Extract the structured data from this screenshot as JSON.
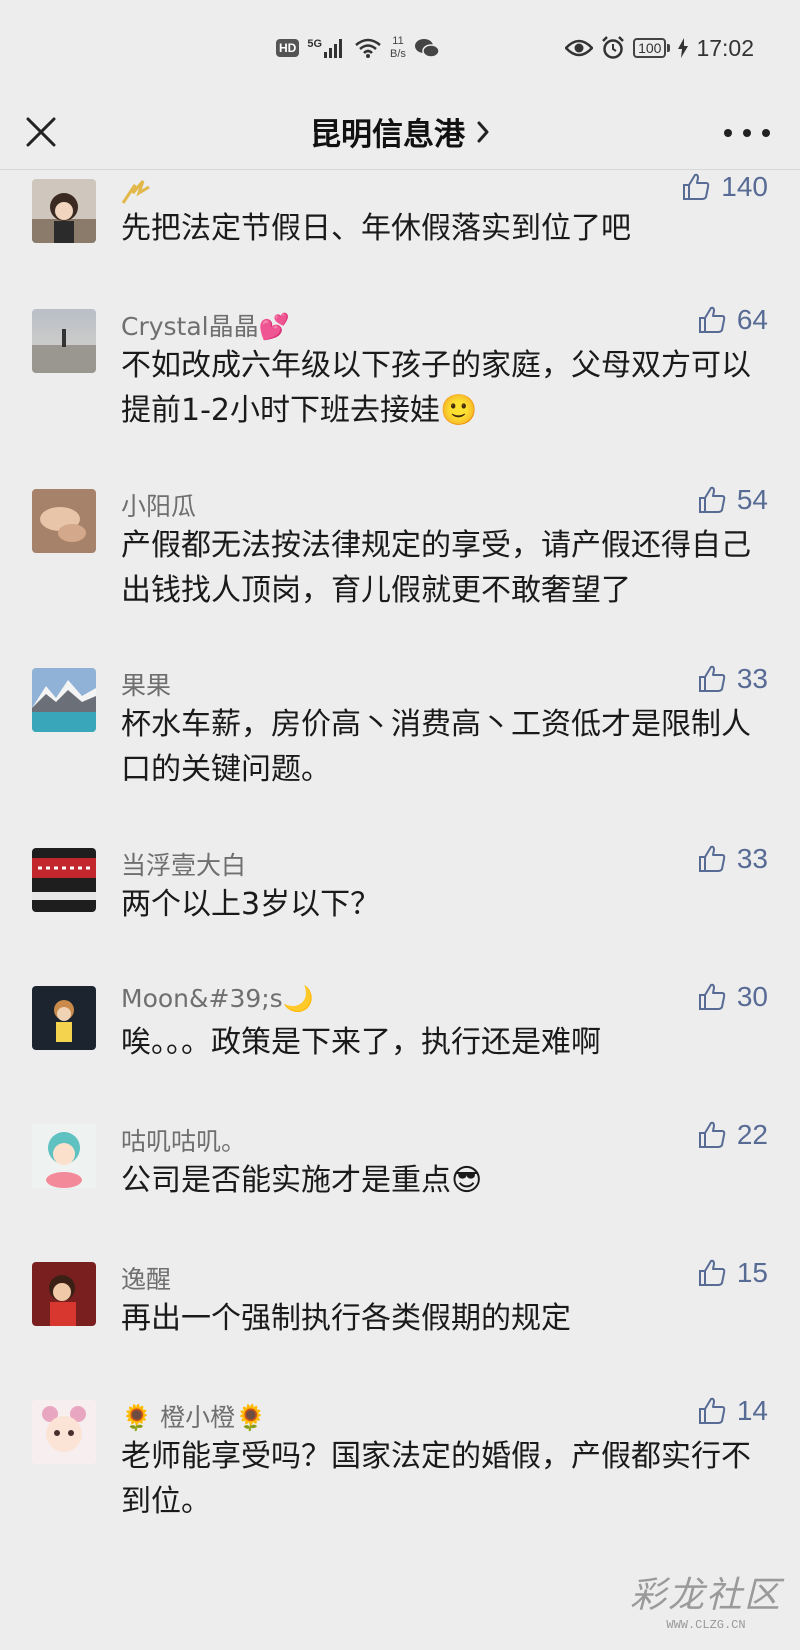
{
  "status_bar": {
    "hd": "HD",
    "signal": "5G",
    "net_speed_value": "11",
    "net_speed_unit": "B/s",
    "battery": "100",
    "time": "17:02"
  },
  "header": {
    "title": "昆明信息港"
  },
  "comments": [
    {
      "name": "",
      "text": "先把法定节假日、年休假落实到位了吧",
      "likes": "140"
    },
    {
      "name": "Crystal晶晶💕",
      "text": "不如改成六年级以下孩子的家庭，父母双方可以提前1-2小时下班去接娃🙂",
      "likes": "64"
    },
    {
      "name": "小阳瓜",
      "text": "产假都无法按法律规定的享受，请产假还得自己出钱找人顶岗，育儿假就更不敢奢望了",
      "likes": "54"
    },
    {
      "name": "果果",
      "text": "杯水车薪，房价高丶消费高丶工资低才是限制人口的关键问题。",
      "likes": "33"
    },
    {
      "name": "当浮壹大白",
      "text": "两个以上3岁以下？",
      "likes": "33"
    },
    {
      "name": "Moon&#39;s🌙",
      "text": "唉。。。政策是下来了，执行还是难啊",
      "likes": "30"
    },
    {
      "name": "咕叽咕叽。",
      "text": "公司是否能实施才是重点😎",
      "likes": "22"
    },
    {
      "name": "逸醒",
      "text": "再出一个强制执行各类假期的规定",
      "likes": "15"
    },
    {
      "name": "🌻 橙小橙🌻",
      "text": "老师能享受吗？国家法定的婚假，产假都实行不到位。",
      "likes": "14"
    }
  ],
  "watermark": {
    "main": "彩龙社区",
    "sub": "WWW.CLZG.CN"
  },
  "colors": {
    "background": "#ededed",
    "like_blue": "#576b95",
    "name_gray": "#6f6f6f"
  },
  "icons": {
    "close": "close-icon",
    "more": "more-icon",
    "like": "thumbs-up-icon",
    "chevron": "chevron-right-icon"
  }
}
